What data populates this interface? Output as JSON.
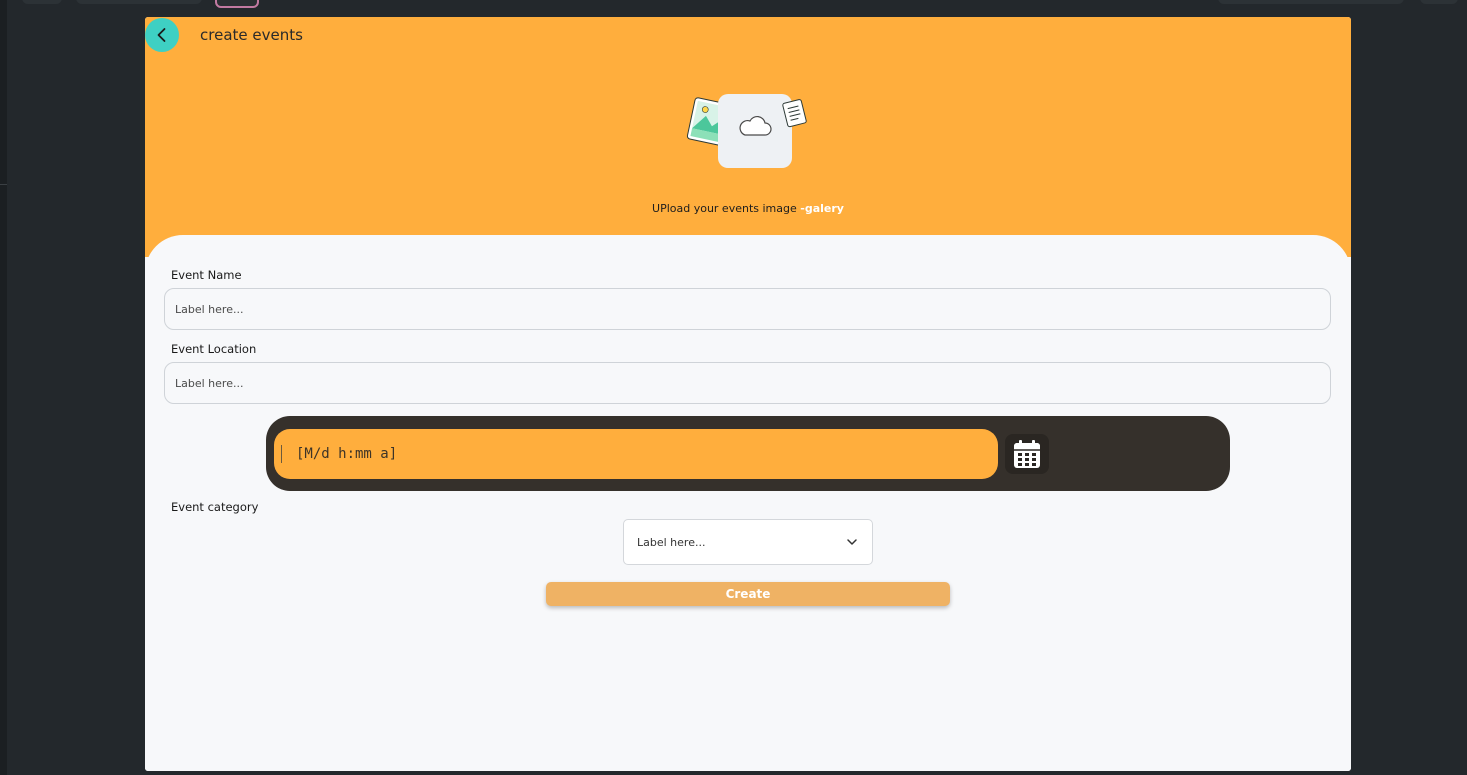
{
  "header": {
    "title": "create events",
    "upload_caption": "UPload your events image",
    "upload_link": "-galery"
  },
  "form": {
    "event_name": {
      "label": "Event Name",
      "placeholder": "Label here..."
    },
    "event_location": {
      "label": "Event Location",
      "placeholder": "Label here..."
    },
    "date_time": {
      "format_hint": "[M/d h:mm a]"
    },
    "event_category": {
      "label": "Event category",
      "selected": "Label here..."
    },
    "submit_label": "Create"
  },
  "colors": {
    "header_bg": "#ffae3d",
    "back_button": "#3ed0c3",
    "date_bar": "#35302b",
    "create_button": "#efb264"
  },
  "icons": {
    "back": "chevron-left-icon",
    "upload": "upload-illustration-icon",
    "calendar": "calendar-icon",
    "dropdown": "chevron-down-icon"
  }
}
